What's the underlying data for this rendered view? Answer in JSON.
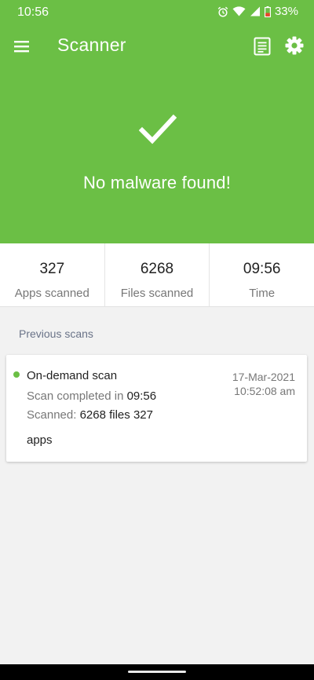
{
  "status": {
    "time": "10:56",
    "battery": "33%"
  },
  "appbar": {
    "title": "Scanner"
  },
  "hero": {
    "message": "No malware found!"
  },
  "stats": [
    {
      "value": "327",
      "label": "Apps scanned"
    },
    {
      "value": "6268",
      "label": "Files scanned"
    },
    {
      "value": "09:56",
      "label": "Time"
    }
  ],
  "previous": {
    "label": "Previous scans",
    "items": [
      {
        "title": "On-demand scan",
        "completed_prefix": "Scan completed in ",
        "completed_time": "09:56",
        "scanned_prefix": "Scanned: ",
        "scanned_value": "6268 files 327",
        "scanned_tail": "apps",
        "date": "17-Mar-2021",
        "time": "10:52:08 am",
        "status_color": "#6bbf45"
      }
    ]
  },
  "colors": {
    "accent": "#6bbf45"
  }
}
